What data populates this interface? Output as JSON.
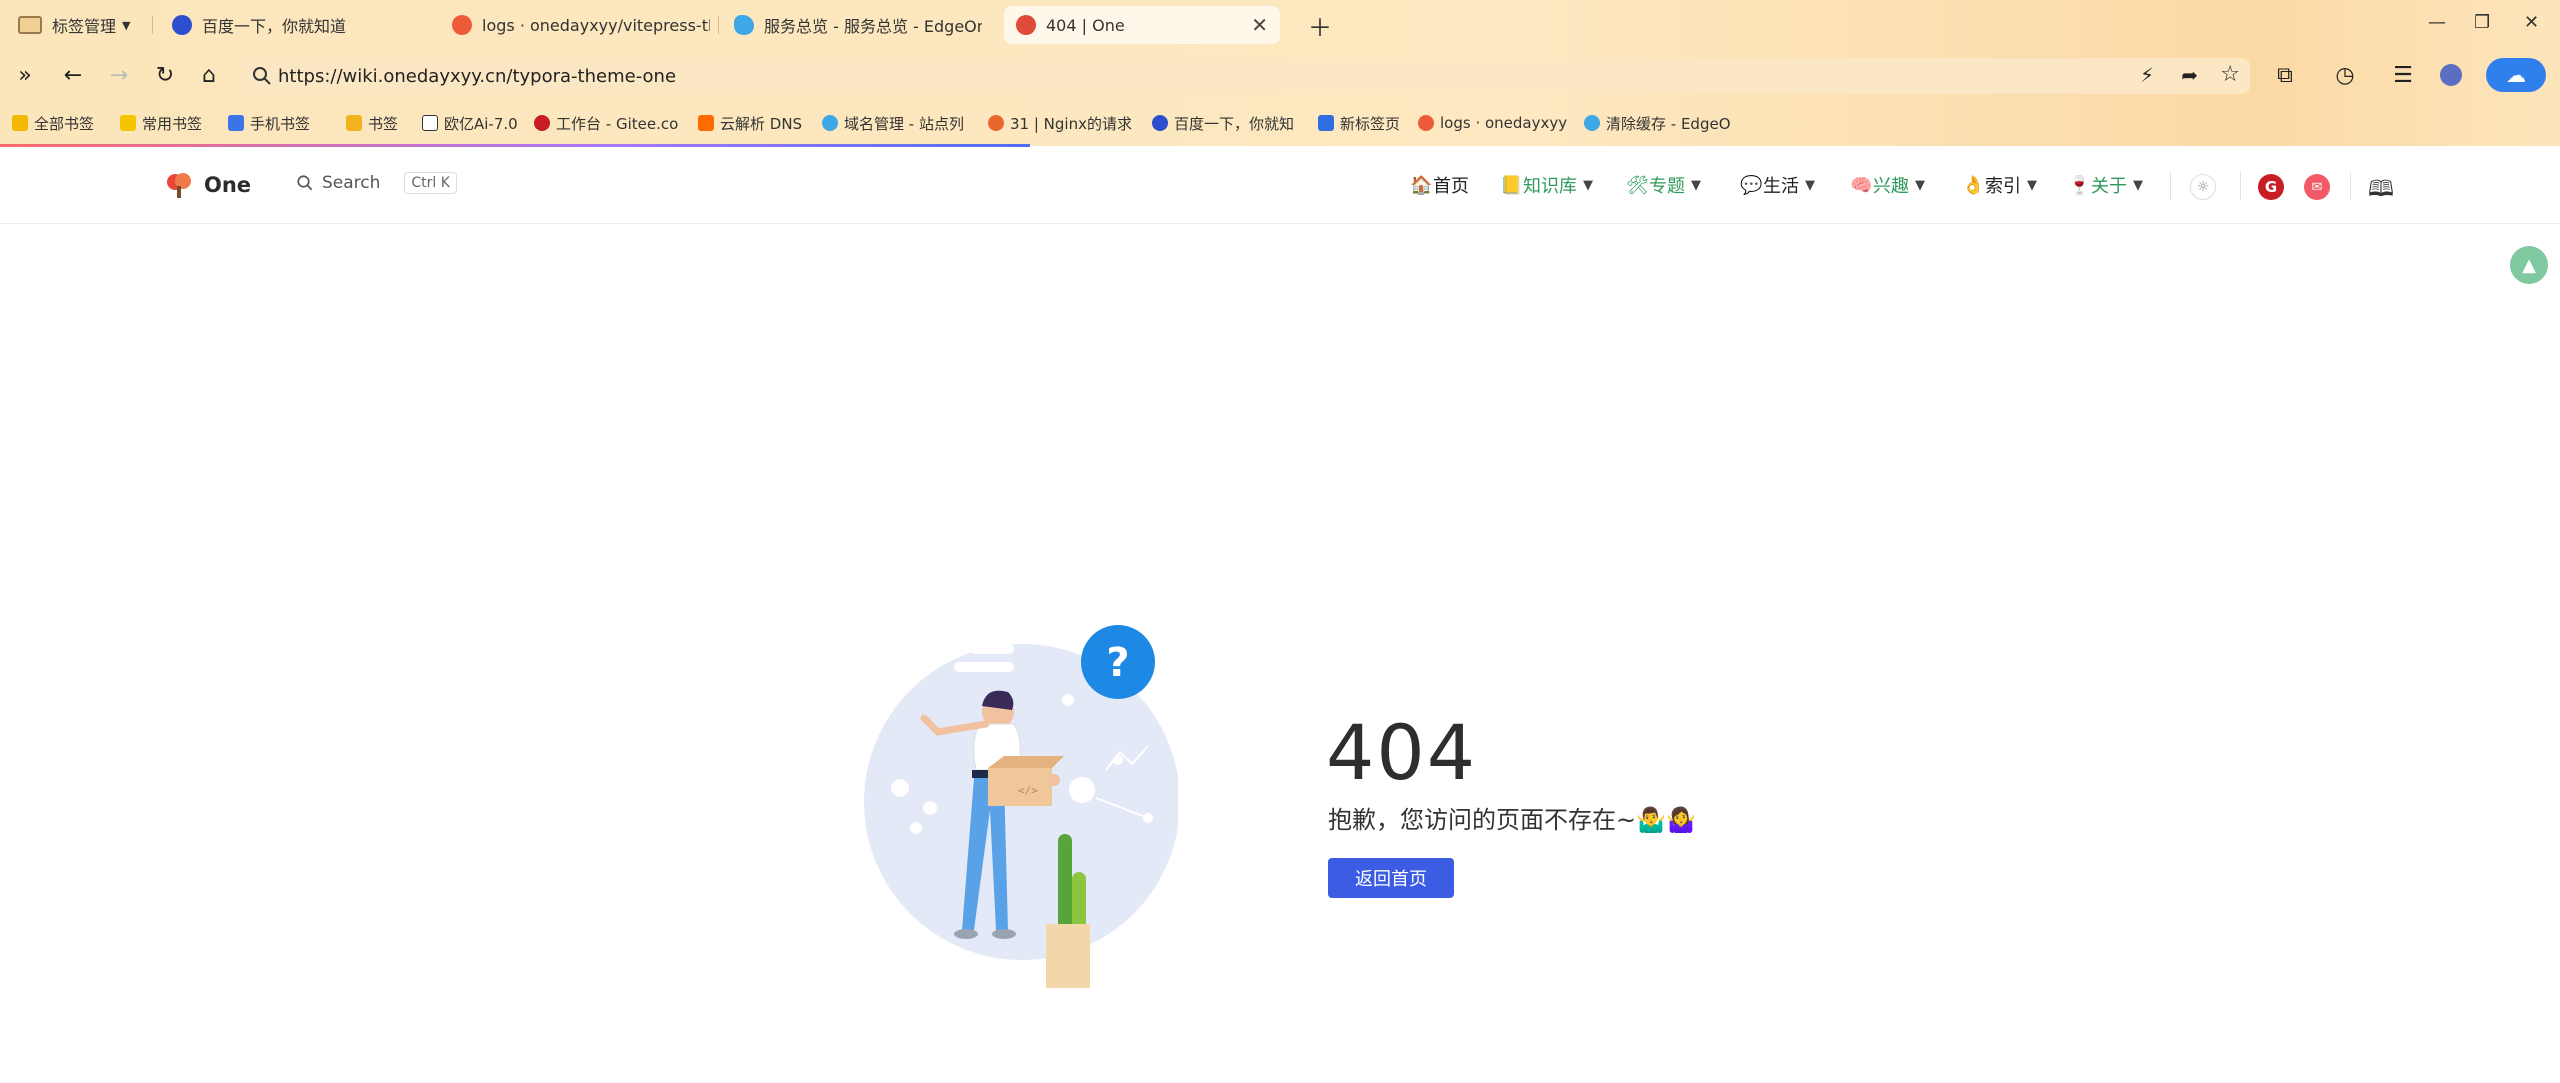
{
  "tabs": [
    {
      "label": "标签管理"
    },
    {
      "label": "百度一下，你就知道"
    },
    {
      "label": "logs · onedayxyy/vitepress-the"
    },
    {
      "label": "服务总览 - 服务总览 - EdgeOne"
    },
    {
      "label": "404 | One"
    }
  ],
  "address": {
    "url": "https://wiki.onedayxyy.cn/typora-theme-one"
  },
  "bookmarks": [
    "全部书签",
    "常用书签",
    "手机书签",
    "书签",
    "欧亿Ai-7.0",
    "工作台 - Gitee.co",
    "云解析 DNS",
    "域名管理 - 站点列",
    "31 | Nginx的请求",
    "百度一下，你就知",
    "新标签页",
    "logs · onedayxyy",
    "清除缓存 - EdgeO"
  ],
  "site": {
    "name": "One",
    "search_label": "Search",
    "search_shortcut": "Ctrl K",
    "nav": [
      {
        "label": "首页"
      },
      {
        "label": "知识库"
      },
      {
        "label": "专题"
      },
      {
        "label": "生活"
      },
      {
        "label": "兴趣"
      },
      {
        "label": "索引"
      },
      {
        "label": "关于"
      }
    ]
  },
  "notfound": {
    "code": "404",
    "message": "抱歉，您访问的页面不存在~🤷‍♂️🤷‍♀️",
    "home_button": "返回首页"
  },
  "colors": {
    "accent_button": "#3d5ce4",
    "nav_highlight": "#2e9a5a"
  }
}
